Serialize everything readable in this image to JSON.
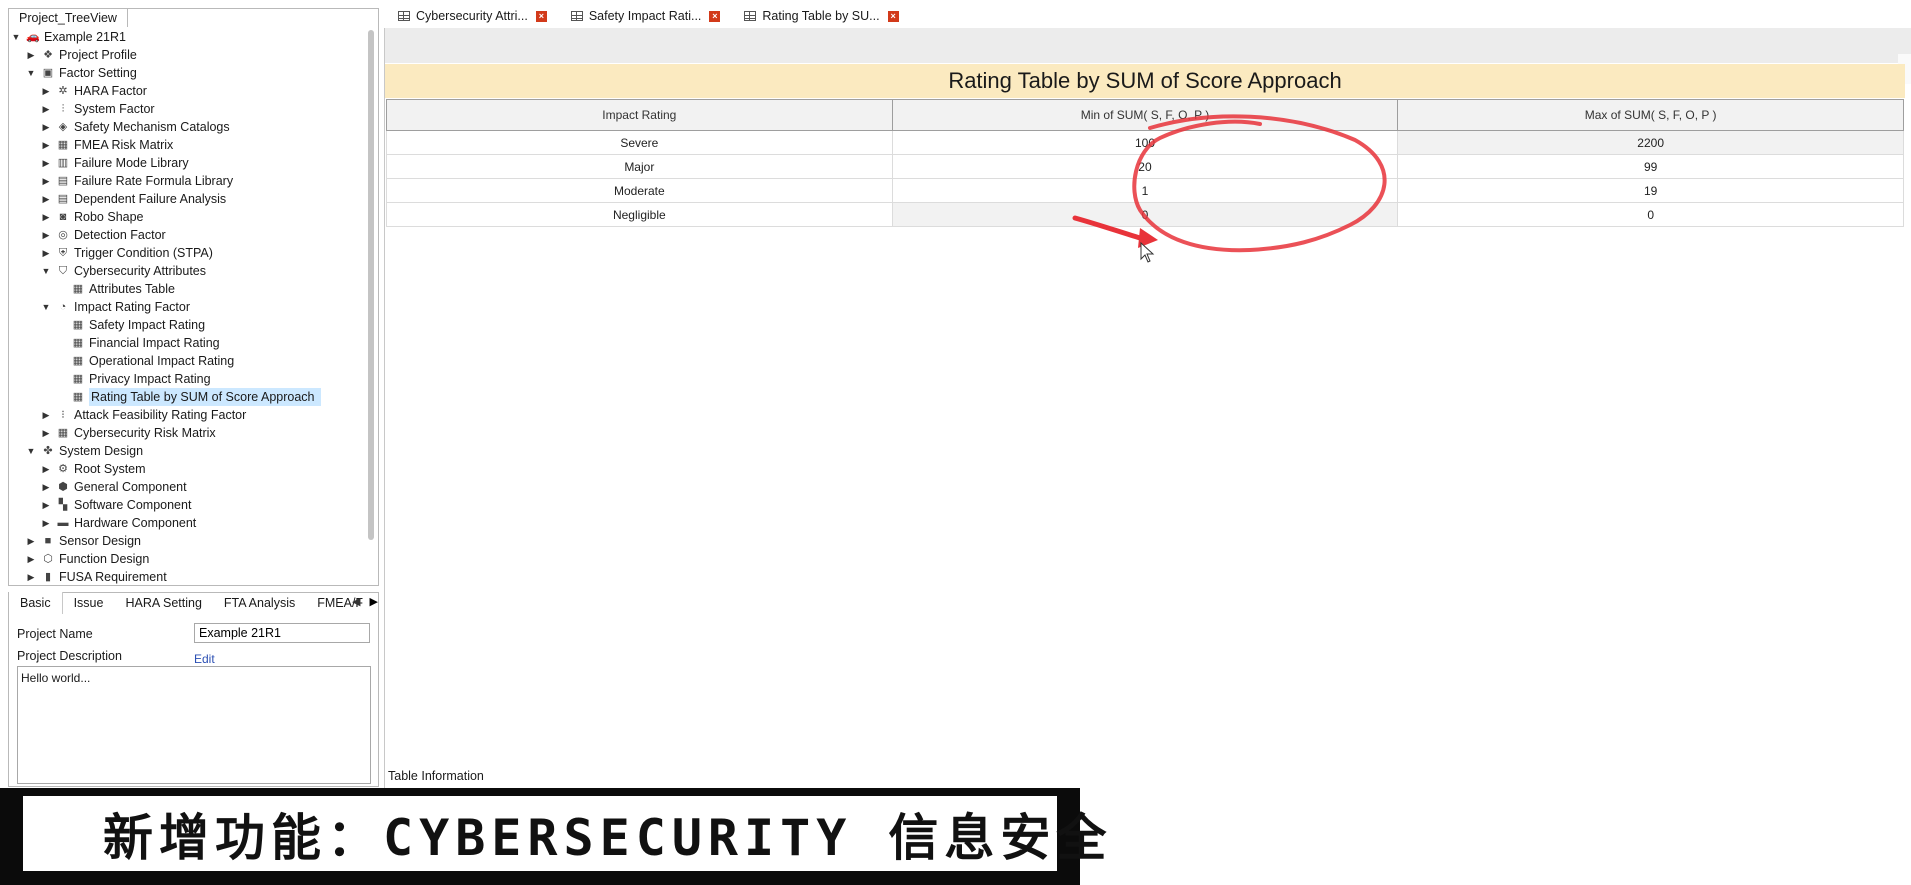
{
  "tree": {
    "tab_label": "Project_TreeView",
    "items": [
      {
        "label": "Example 21R1",
        "icon": "car-icon",
        "level": 0,
        "arrow": "down"
      },
      {
        "label": "Project Profile",
        "icon": "layers-icon",
        "level": 1,
        "arrow": "right"
      },
      {
        "label": "Factor Setting",
        "icon": "factor-icon",
        "level": 1,
        "arrow": "down"
      },
      {
        "label": "HARA Factor",
        "icon": "hara-icon",
        "level": 2,
        "arrow": "right"
      },
      {
        "label": "System Factor",
        "icon": "sliders-icon",
        "level": 2,
        "arrow": "right"
      },
      {
        "label": "Safety Mechanism Catalogs",
        "icon": "cube-icon",
        "level": 2,
        "arrow": "right"
      },
      {
        "label": "FMEA Risk Matrix",
        "icon": "matrix-icon",
        "level": 2,
        "arrow": "right"
      },
      {
        "label": "Failure Mode Library",
        "icon": "library-icon",
        "level": 2,
        "arrow": "right"
      },
      {
        "label": "Failure Rate Formula Library",
        "icon": "formula-icon",
        "level": 2,
        "arrow": "right"
      },
      {
        "label": "Dependent Failure Analysis",
        "icon": "document-icon",
        "level": 2,
        "arrow": "right"
      },
      {
        "label": "Robo Shape",
        "icon": "robot-icon",
        "level": 2,
        "arrow": "right"
      },
      {
        "label": "Detection Factor",
        "icon": "target-icon",
        "level": 2,
        "arrow": "right"
      },
      {
        "label": "Trigger Condition (STPA)",
        "icon": "shield-icon",
        "level": 2,
        "arrow": "right"
      },
      {
        "label": "Cybersecurity Attributes",
        "icon": "shield-outline-icon",
        "level": 2,
        "arrow": "down"
      },
      {
        "label": "Attributes Table",
        "icon": "table-icon",
        "level": 3,
        "arrow": ""
      },
      {
        "label": "Impact Rating Factor",
        "icon": "gauge-icon",
        "level": 2,
        "arrow": "down"
      },
      {
        "label": "Safety Impact Rating",
        "icon": "table-icon",
        "level": 3,
        "arrow": ""
      },
      {
        "label": "Financial Impact Rating",
        "icon": "table-icon",
        "level": 3,
        "arrow": ""
      },
      {
        "label": "Operational Impact Rating",
        "icon": "table-icon",
        "level": 3,
        "arrow": ""
      },
      {
        "label": "Privacy Impact Rating",
        "icon": "table-icon",
        "level": 3,
        "arrow": ""
      },
      {
        "label": "Rating Table by SUM of Score Approach",
        "icon": "table-icon",
        "level": 3,
        "arrow": "",
        "selected": true
      },
      {
        "label": "Attack Feasibility Rating Factor",
        "icon": "feasibility-icon",
        "level": 2,
        "arrow": "right"
      },
      {
        "label": "Cybersecurity Risk Matrix",
        "icon": "risk-matrix-icon",
        "level": 2,
        "arrow": "right"
      },
      {
        "label": "System Design",
        "icon": "system-icon",
        "level": 1,
        "arrow": "down"
      },
      {
        "label": "Root System",
        "icon": "gear-icon",
        "level": 2,
        "arrow": "right"
      },
      {
        "label": "General Component",
        "icon": "component-icon",
        "level": 2,
        "arrow": "right"
      },
      {
        "label": "Software Component",
        "icon": "software-icon",
        "level": 2,
        "arrow": "right"
      },
      {
        "label": "Hardware Component",
        "icon": "hardware-icon",
        "level": 2,
        "arrow": "right"
      },
      {
        "label": "Sensor Design",
        "icon": "camera-icon",
        "level": 1,
        "arrow": "right"
      },
      {
        "label": "Function Design",
        "icon": "function-icon",
        "level": 1,
        "arrow": "right"
      },
      {
        "label": "FUSA Requirement",
        "icon": "requirement-icon",
        "level": 1,
        "arrow": "right"
      }
    ]
  },
  "properties": {
    "tabs": [
      "Basic",
      "Issue",
      "HARA Setting",
      "FTA Analysis",
      "FMEA/F"
    ],
    "project_name_label": "Project Name",
    "project_name_value": "Example 21R1",
    "project_description_label": "Project Description",
    "edit_label": "Edit",
    "description_value": "Hello world..."
  },
  "doc_tabs": [
    {
      "label": "Cybersecurity Attri...",
      "active": false
    },
    {
      "label": "Safety Impact Rati...",
      "active": false
    },
    {
      "label": "Rating Table by SU...",
      "active": true
    }
  ],
  "main": {
    "title": "Rating Table by SUM of Score Approach",
    "columns": [
      "Impact Rating",
      "Min of SUM( S, F, O, P )",
      "Max of SUM( S, F, O, P )"
    ],
    "rows": [
      {
        "rating": "Severe",
        "min": "100",
        "max": "2200"
      },
      {
        "rating": "Major",
        "min": "20",
        "max": "99"
      },
      {
        "rating": "Moderate",
        "min": "1",
        "max": "19"
      },
      {
        "rating": "Negligible",
        "min": "0",
        "max": "0"
      }
    ],
    "table_info_label": "Table Information"
  },
  "caption": "新增功能：CYBERSECURITY 信息安全",
  "colors": {
    "title_bg": "#fbeac0",
    "selected_bg": "#cce8ff",
    "tab_close": "#d23a1a",
    "annotation_stroke": "#e8333a"
  }
}
